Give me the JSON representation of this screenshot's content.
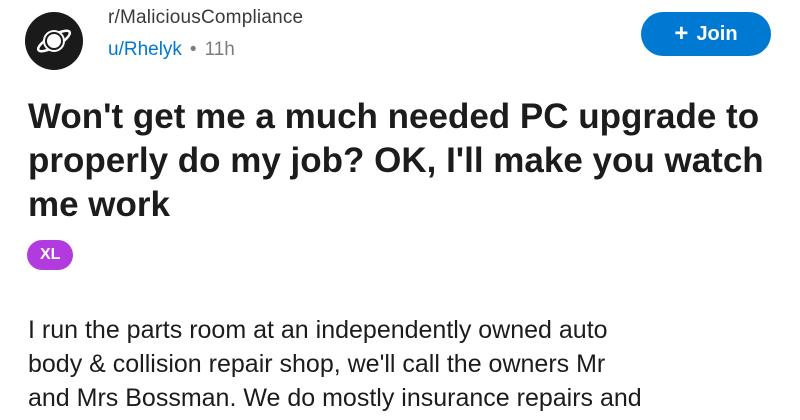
{
  "post": {
    "subreddit": "r/MaliciousCompliance",
    "username": "u/Rhelyk",
    "separator": "•",
    "time": "11h",
    "join_label": "Join",
    "join_icon": "plus-icon",
    "avatar_icon": "planet-icon",
    "title": "Won't get me a much needed PC upgrade to properly do my job? OK, I'll make you watch me work",
    "flair": "XL",
    "body_lines": [
      "I run the parts room at an independently owned auto",
      "body & collision repair shop, we'll call the owners Mr",
      "and Mrs Bossman. We do mostly insurance repairs and"
    ]
  },
  "colors": {
    "accent": "#0079d3",
    "flair": "#b23be0",
    "avatar_bg": "#1a1a1b"
  }
}
